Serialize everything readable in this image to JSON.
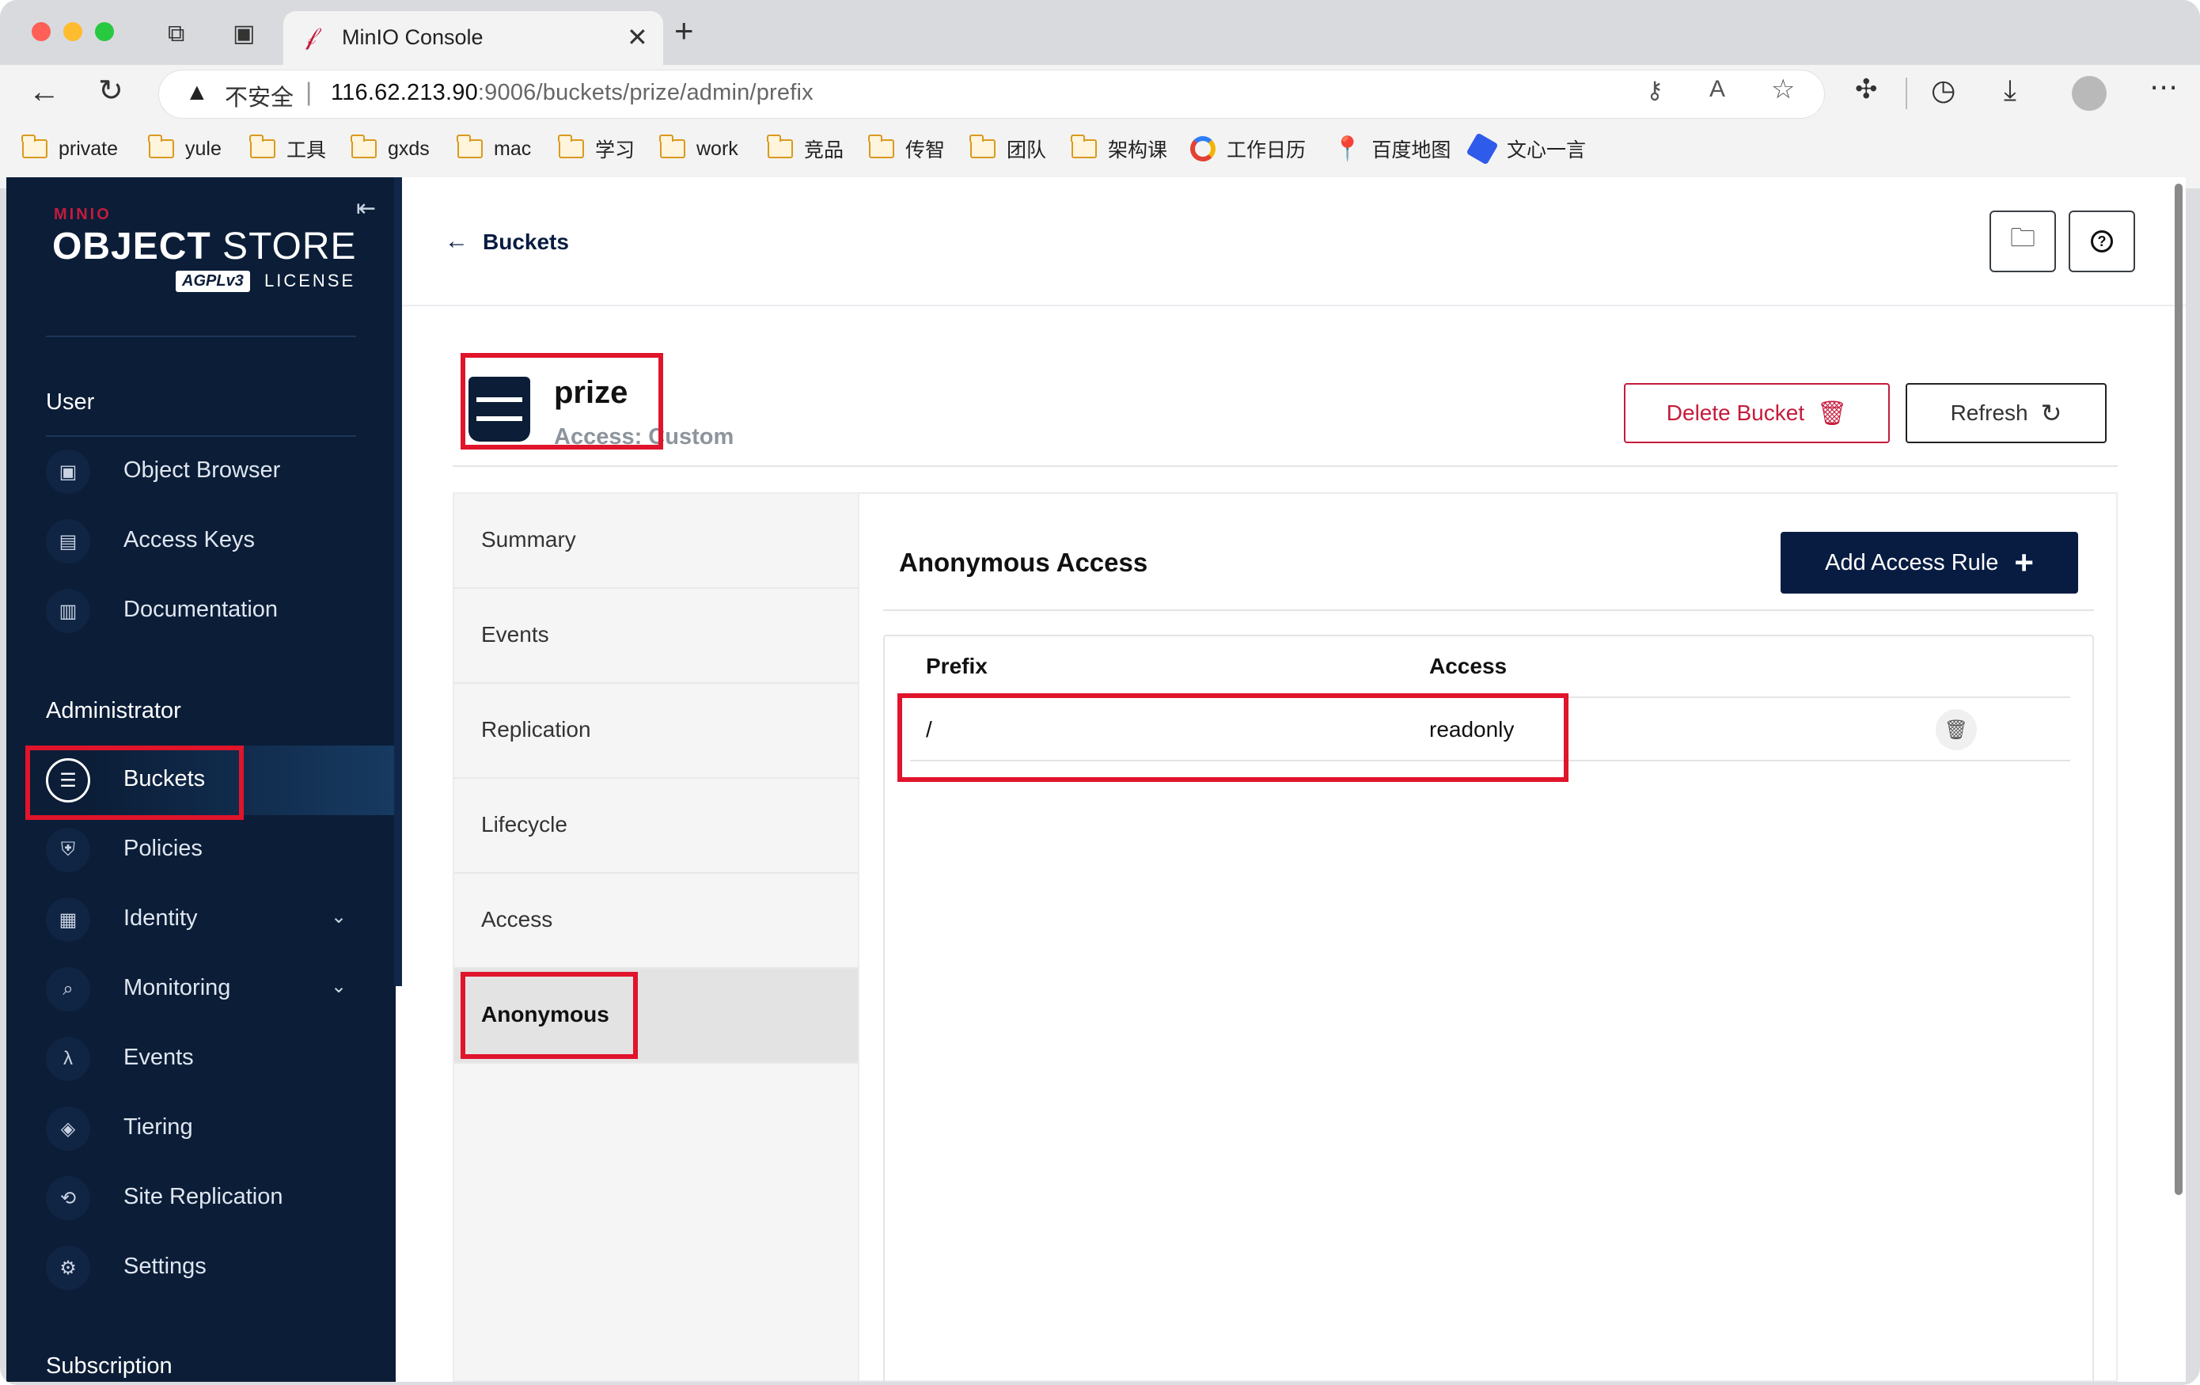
{
  "browser": {
    "tab_title": "MinIO Console",
    "security_label": "不安全",
    "url_host": "116.62.213.90",
    "url_rest": ":9006/buckets/prize/admin/prefix",
    "bookmarks": [
      "private",
      "yule",
      "工具",
      "gxds",
      "mac",
      "学习",
      "work",
      "竞品",
      "传智",
      "团队",
      "架构课",
      "工作日历",
      "百度地图",
      "文心一言"
    ]
  },
  "sidebar": {
    "logo_brand": "MINIO",
    "logo_title_bold": "OBJECT",
    "logo_title_light": "STORE",
    "logo_license_badge": "AGPLv3",
    "logo_license": "LICENSE",
    "user_section": "User",
    "user_items": [
      "Object Browser",
      "Access Keys",
      "Documentation"
    ],
    "admin_section": "Administrator",
    "admin_items": [
      "Buckets",
      "Policies",
      "Identity",
      "Monitoring",
      "Events",
      "Tiering",
      "Site Replication",
      "Settings"
    ],
    "subscription_section": "Subscription"
  },
  "header": {
    "back_label": "Buckets"
  },
  "bucket": {
    "name": "prize",
    "access_text": "Access: Custom",
    "delete_label": "Delete Bucket",
    "refresh_label": "Refresh"
  },
  "tabs": [
    "Summary",
    "Events",
    "Replication",
    "Lifecycle",
    "Access",
    "Anonymous"
  ],
  "active_tab": "Anonymous",
  "anonymous": {
    "title": "Anonymous Access",
    "add_rule_label": "Add Access Rule",
    "columns": [
      "Prefix",
      "Access"
    ],
    "rows": [
      {
        "prefix": "/",
        "access": "readonly"
      }
    ]
  },
  "colors": {
    "sidebar_bg": "#0b1d37",
    "accent_red": "#c51b3d",
    "primary_dark": "#081c42",
    "highlight_box": "#e0142b"
  }
}
